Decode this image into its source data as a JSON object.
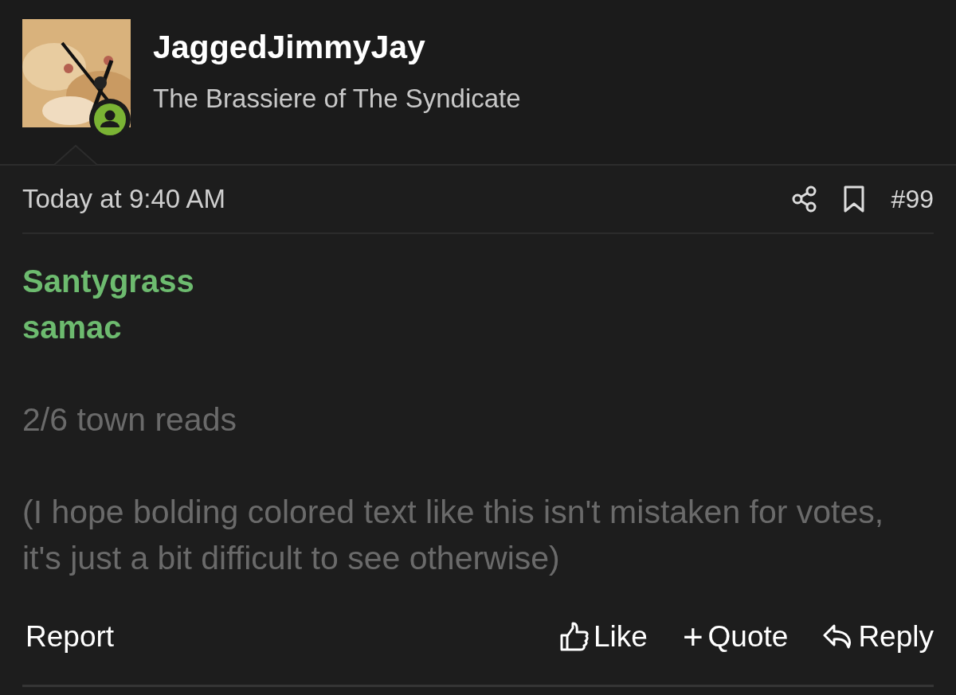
{
  "author": {
    "name": "JaggedJimmyJay",
    "title": "The Brassiere of The Syndicate"
  },
  "post": {
    "time": "Today at 9:40 AM",
    "number": "#99",
    "mentions": [
      "Santygrass",
      "samac"
    ],
    "paragraphs": [
      "2/6 town reads",
      "(I hope bolding colored text like this isn't mistaken for votes, it's just a bit difficult to see otherwise)"
    ]
  },
  "actions": {
    "report": "Report",
    "like": "Like",
    "quote": "Quote",
    "quote_symbol": "+",
    "reply": "Reply"
  }
}
